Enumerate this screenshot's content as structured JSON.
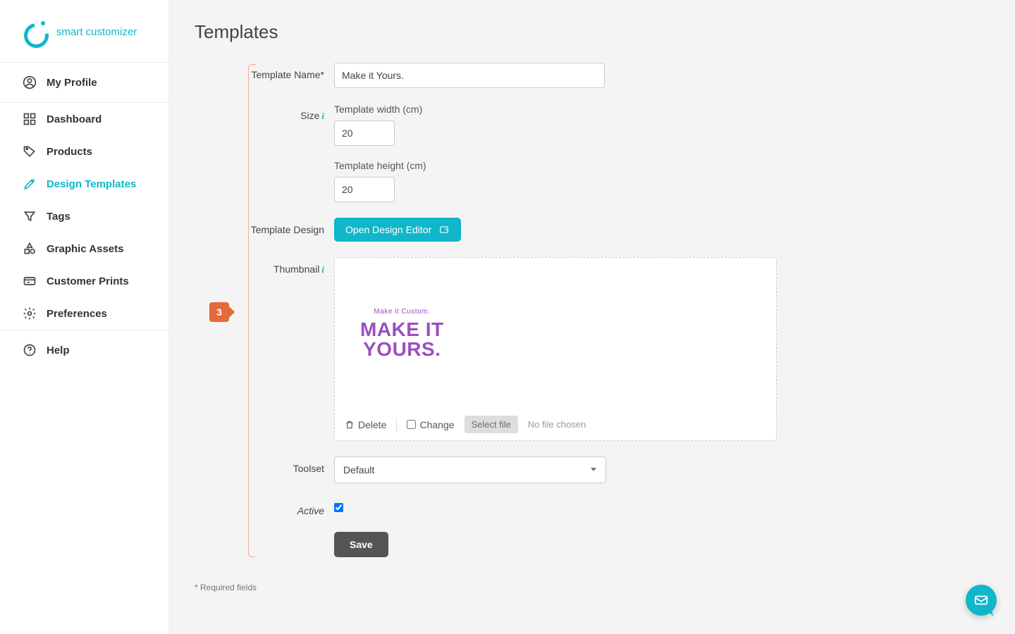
{
  "brand": {
    "name": "smart customizer"
  },
  "sidebar": {
    "profile": "My Profile",
    "items": [
      {
        "label": "Dashboard"
      },
      {
        "label": "Products"
      },
      {
        "label": "Design Templates"
      },
      {
        "label": "Tags"
      },
      {
        "label": "Graphic Assets"
      },
      {
        "label": "Customer Prints"
      },
      {
        "label": "Preferences"
      }
    ],
    "help": "Help"
  },
  "page": {
    "title": "Templates",
    "step": "3"
  },
  "form": {
    "name_label": "Template Name*",
    "name_value": "Make it Yours.",
    "size_label": "Size",
    "width_label": "Template width (cm)",
    "width_value": "20",
    "height_label": "Template height (cm)",
    "height_value": "20",
    "design_label": "Template Design",
    "design_btn": "Open Design Editor",
    "thumb_label": "Thumbnail",
    "thumb_mini": "Make it Custom.",
    "thumb_big1": "MAKE IT",
    "thumb_big2": "YOURS.",
    "thumb_delete": "Delete",
    "thumb_change": "Change",
    "thumb_select": "Select file",
    "thumb_nofile": "No file chosen",
    "toolset_label": "Toolset",
    "toolset_value": "Default",
    "active_label": "Active",
    "active_checked": true,
    "save": "Save"
  },
  "footer": {
    "required": "* Required fields"
  }
}
